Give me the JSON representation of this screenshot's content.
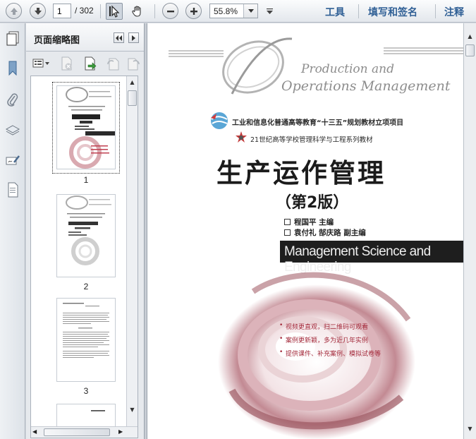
{
  "toolbar": {
    "page_current": "1",
    "page_total": "/ 302",
    "zoom": "55.8%",
    "links": [
      "工具",
      "填写和签名",
      "注释"
    ]
  },
  "thumbnails_panel": {
    "title": "页面缩略图",
    "pages": [
      "1",
      "2",
      "3"
    ]
  },
  "document": {
    "script_line1": "Production and",
    "script_line2": "Operations Management",
    "project_line": "工业和信息化普通高等教育“十三五”规划教材立项项目",
    "series_line": "21世纪高等学校管理科学与工程系列教材",
    "title": "生产运作管理",
    "edition": "（第2版）",
    "author_main": "程国平  主编",
    "author_sub": "袁付礼  郜庆路  副主编",
    "banner": "Management Science and Engineering",
    "bullets": [
      "视频更直观，扫二维码可观看",
      "案例更新颖，多为近几年实例",
      "提供课件、补充案例、模拟试卷等"
    ]
  },
  "colors": {
    "link_blue": "#2f5f95",
    "accent_red": "#a3293a",
    "banner_bg": "#1e1e1e"
  }
}
